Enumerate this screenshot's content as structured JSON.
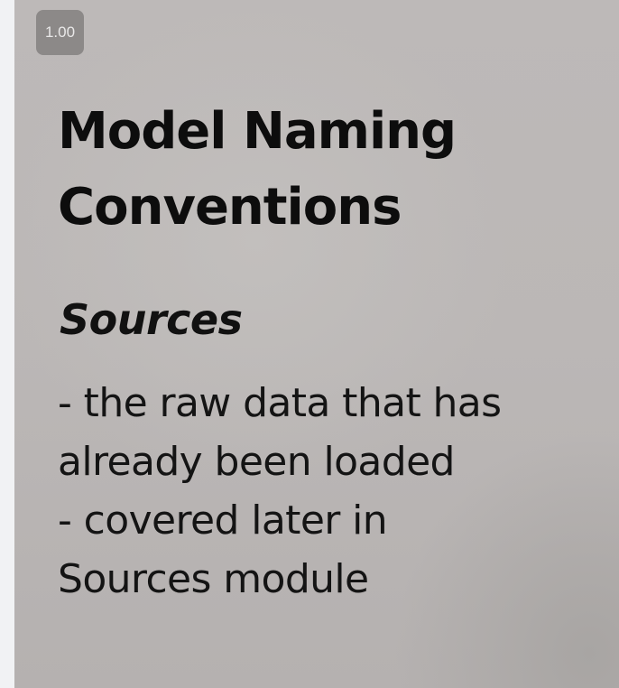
{
  "playback": {
    "speed_label": "1.00"
  },
  "slide": {
    "title": "Model Naming Conventions",
    "section_heading": "Sources",
    "body_lines": [
      "- the raw data that has",
      "already been loaded",
      "- covered later in",
      "Sources module"
    ]
  },
  "colors": {
    "slide_background": "#bbb7b6",
    "badge_background": "#8c8988",
    "text": "#0d0d0d"
  }
}
